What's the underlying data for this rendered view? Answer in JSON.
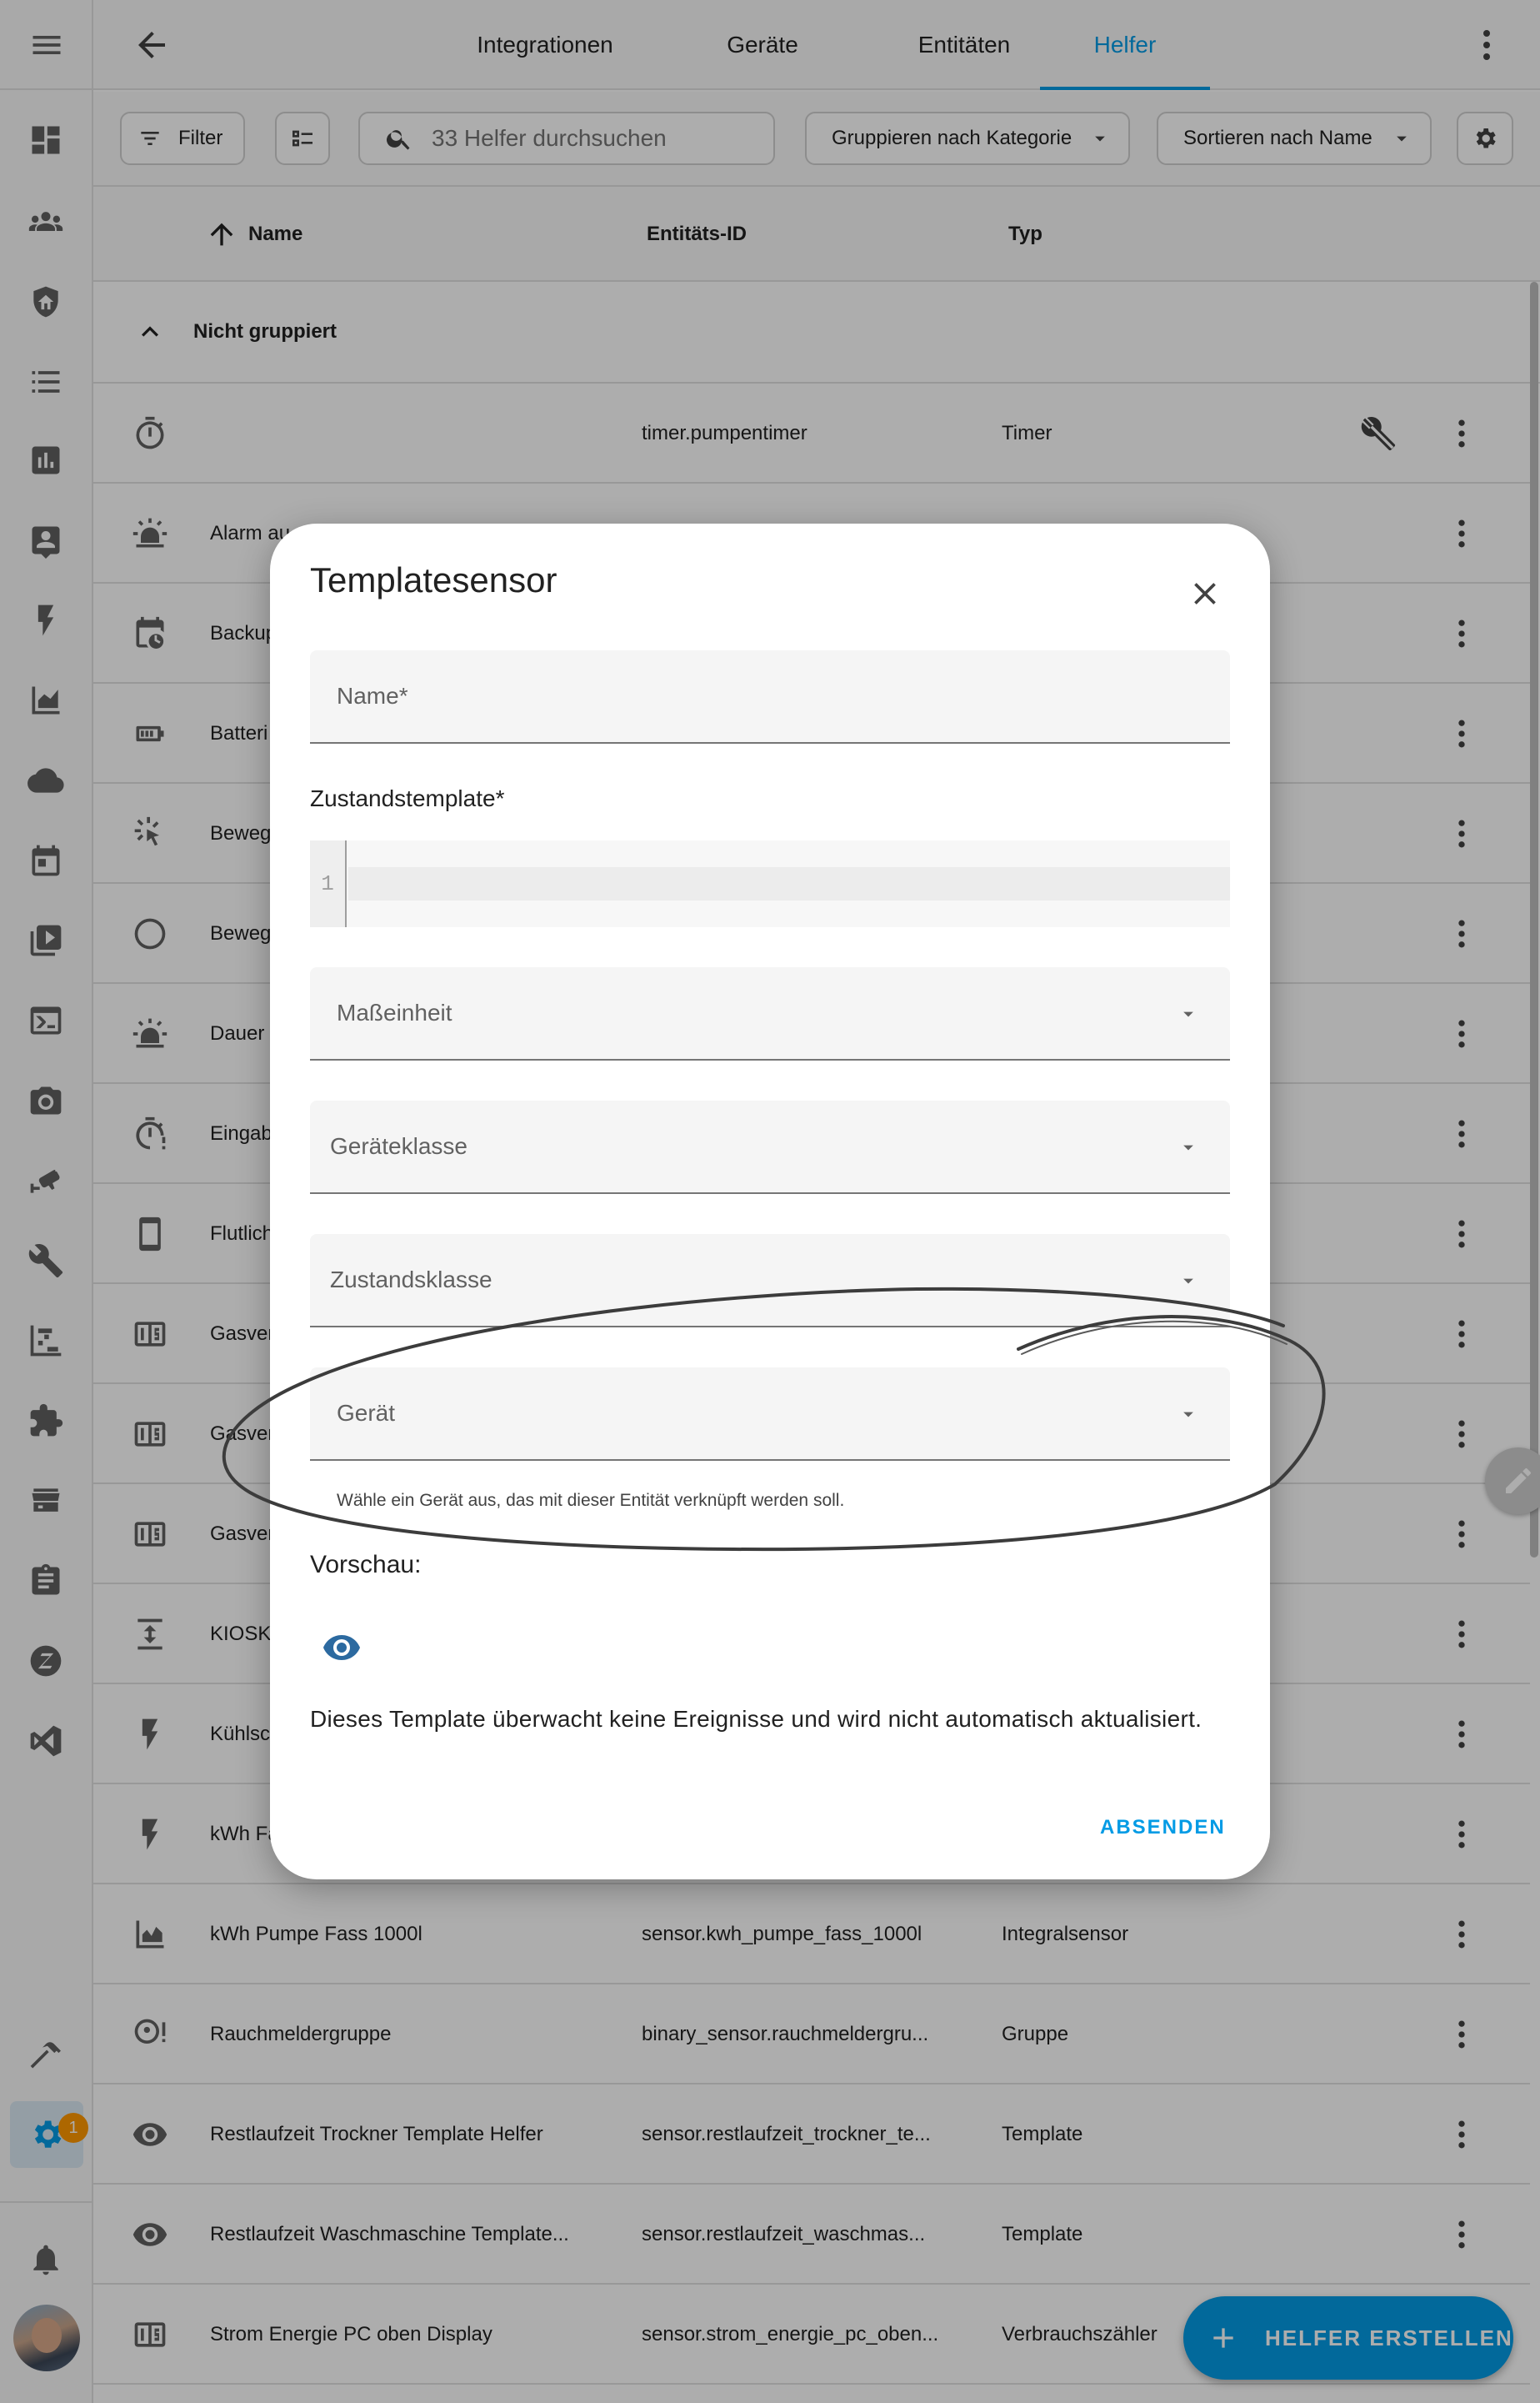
{
  "tabs": [
    {
      "label": "Integrationen"
    },
    {
      "label": "Geräte"
    },
    {
      "label": "Entitäten"
    },
    {
      "label": "Helfer"
    }
  ],
  "toolbar": {
    "filter_label": "Filter",
    "search_placeholder": "33 Helfer durchsuchen",
    "group_label": "Gruppieren nach Kategorie",
    "sort_label": "Sortieren nach Name"
  },
  "table": {
    "col_name": "Name",
    "col_id": "Entitäts-ID",
    "col_type": "Typ",
    "group_title": "Nicht gruppiert",
    "rows": [
      {
        "name": "",
        "id": "timer.pumpentimer",
        "type": "Timer",
        "icon": "timer-icon"
      },
      {
        "name": "Alarm au",
        "id": "",
        "type": "",
        "icon": "alarm-light-icon"
      },
      {
        "name": "Backup",
        "id": "",
        "type": "",
        "icon": "calendar-clock-icon"
      },
      {
        "name": "Batteri",
        "id": "",
        "type": "",
        "icon": "battery-icon"
      },
      {
        "name": "Beweg",
        "id": "",
        "type": "",
        "icon": "motion-sensor-icon"
      },
      {
        "name": "Beweg",
        "id": "",
        "type": "",
        "icon": "circle-outline-icon"
      },
      {
        "name": "Dauer",
        "id": "",
        "type": "",
        "icon": "alarm-light-icon"
      },
      {
        "name": "Eingab",
        "id": "",
        "type": "",
        "icon": "timer-alert-icon"
      },
      {
        "name": "Flutlich",
        "id": "",
        "type": "",
        "icon": "cellphone-icon"
      },
      {
        "name": "Gasver",
        "id": "",
        "type": "",
        "icon": "counter-icon"
      },
      {
        "name": "Gasver",
        "id": "",
        "type": "",
        "icon": "counter-icon"
      },
      {
        "name": "Gasver",
        "id": "",
        "type": "",
        "icon": "counter-icon"
      },
      {
        "name": "KIOSK",
        "id": "",
        "type": "",
        "icon": "vertical-arrows-icon"
      },
      {
        "name": "Kühlsc",
        "id": "",
        "type": "",
        "icon": "flash-icon"
      },
      {
        "name": "kWh Fa",
        "id": "",
        "type": "",
        "icon": "flash-icon"
      },
      {
        "name": "kWh Pumpe Fass 1000l",
        "id": "sensor.kwh_pumpe_fass_1000l",
        "type": "Integralsensor",
        "icon": "area-chart-icon"
      },
      {
        "name": "Rauchmeldergruppe",
        "id": "binary_sensor.rauchmeldergru...",
        "type": "Gruppe",
        "icon": "smoke-detector-icon"
      },
      {
        "name": "Restlaufzeit Trockner Template Helfer",
        "id": "sensor.restlaufzeit_trockner_te...",
        "type": "Template",
        "icon": "eye-icon"
      },
      {
        "name": "Restlaufzeit Waschmaschine Template...",
        "id": "sensor.restlaufzeit_waschmas...",
        "type": "Template",
        "icon": "eye-icon"
      },
      {
        "name": "Strom Energie PC oben Display",
        "id": "sensor.strom_energie_pc_oben...",
        "type": "Verbrauchszähler",
        "icon": "counter-icon"
      }
    ]
  },
  "sidebar": {
    "notification_badge": "1"
  },
  "dialog": {
    "title": "Templatesensor",
    "name_label": "Name*",
    "state_template_label": "Zustandstemplate*",
    "code_line_number": "1",
    "unit_label": "Maßeinheit",
    "device_class_label": "Geräteklasse",
    "state_class_label": "Zustandsklasse",
    "device_label": "Gerät",
    "device_hint": "Wähle ein Gerät aus, das mit dieser Entität verknüpft werden soll.",
    "preview_label": "Vorschau:",
    "preview_text": "Dieses Template überwacht keine Ereignisse und wird nicht automatisch aktualisiert.",
    "submit_label": "ABSENDEN"
  },
  "fab": {
    "label": "HELFER ERSTELLEN"
  },
  "colors": {
    "accent": "#039be5",
    "badge": "#ff9800"
  }
}
